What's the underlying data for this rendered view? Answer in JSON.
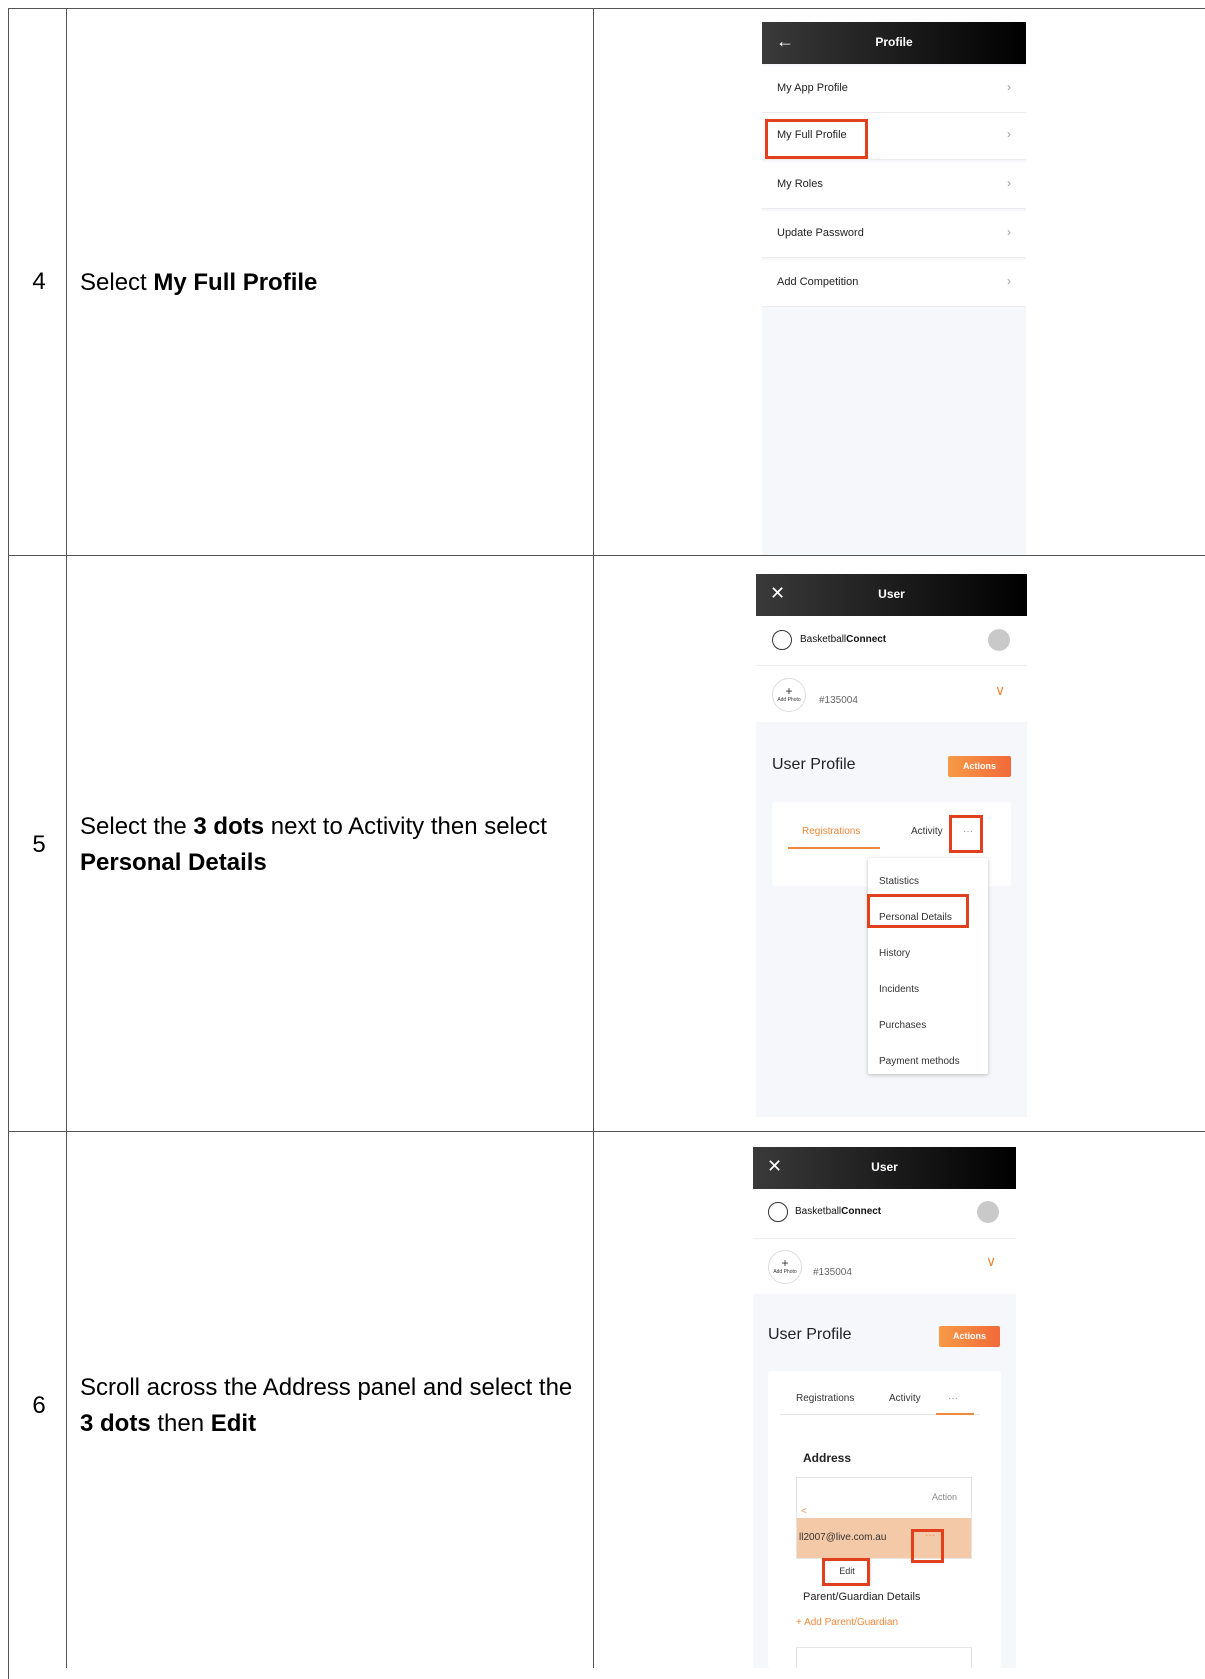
{
  "rows": [
    {
      "step": "4",
      "instruction_parts": [
        {
          "text": "Select ",
          "bold": false
        },
        {
          "text": "My Full Profile",
          "bold": true
        }
      ]
    },
    {
      "step": "5",
      "instruction_parts": [
        {
          "text": "Select the ",
          "bold": false
        },
        {
          "text": "3 dots",
          "bold": true
        },
        {
          "text": " next to Activity then select ",
          "bold": false
        },
        {
          "text": "Personal Details",
          "bold": true
        }
      ]
    },
    {
      "step": "6",
      "instruction_parts": [
        {
          "text": "Scroll across the Address panel and select the ",
          "bold": false
        },
        {
          "text": "3 dots",
          "bold": true
        },
        {
          "text": " then ",
          "bold": false
        },
        {
          "text": "Edit",
          "bold": true
        }
      ]
    }
  ],
  "screen1": {
    "title": "Profile",
    "back_icon": "arrow-left-icon",
    "items": [
      "My App Profile",
      "My Full Profile",
      "My Roles",
      "Update Password",
      "Add Competition"
    ],
    "chevron": "›"
  },
  "screen2": {
    "title": "User",
    "close_icon": "close-icon",
    "brand_regular": "Basketball",
    "brand_bold": "Connect",
    "add_photo_plus": "+",
    "add_photo_label": "Add Photo",
    "user_id": "#135004",
    "page_title": "User Profile",
    "actions": "Actions",
    "tabs": [
      "Registrations",
      "Activity",
      "···"
    ],
    "dropdown": [
      "Statistics",
      "Personal Details",
      "History",
      "Incidents",
      "Purchases",
      "Payment methods"
    ]
  },
  "screen3": {
    "title": "User",
    "brand_regular": "Basketball",
    "brand_bold": "Connect",
    "add_photo_plus": "+",
    "add_photo_label": "Add Photo",
    "user_id": "#135004",
    "page_title": "User Profile",
    "actions": "Actions",
    "tabs": [
      "Registrations",
      "Activity",
      "···"
    ],
    "address_heading": "Address",
    "action_col": "Action",
    "scroll_left": "<",
    "email": "ll2007@live.com.au",
    "dots": "···",
    "edit": "Edit",
    "parent_heading": "Parent/Guardian Details",
    "add_parent": "+ Add Parent/Guardian"
  },
  "colors": {
    "accent": "#f0883c",
    "highlight": "#e2401c",
    "row_bg": "#f4c9a8"
  }
}
